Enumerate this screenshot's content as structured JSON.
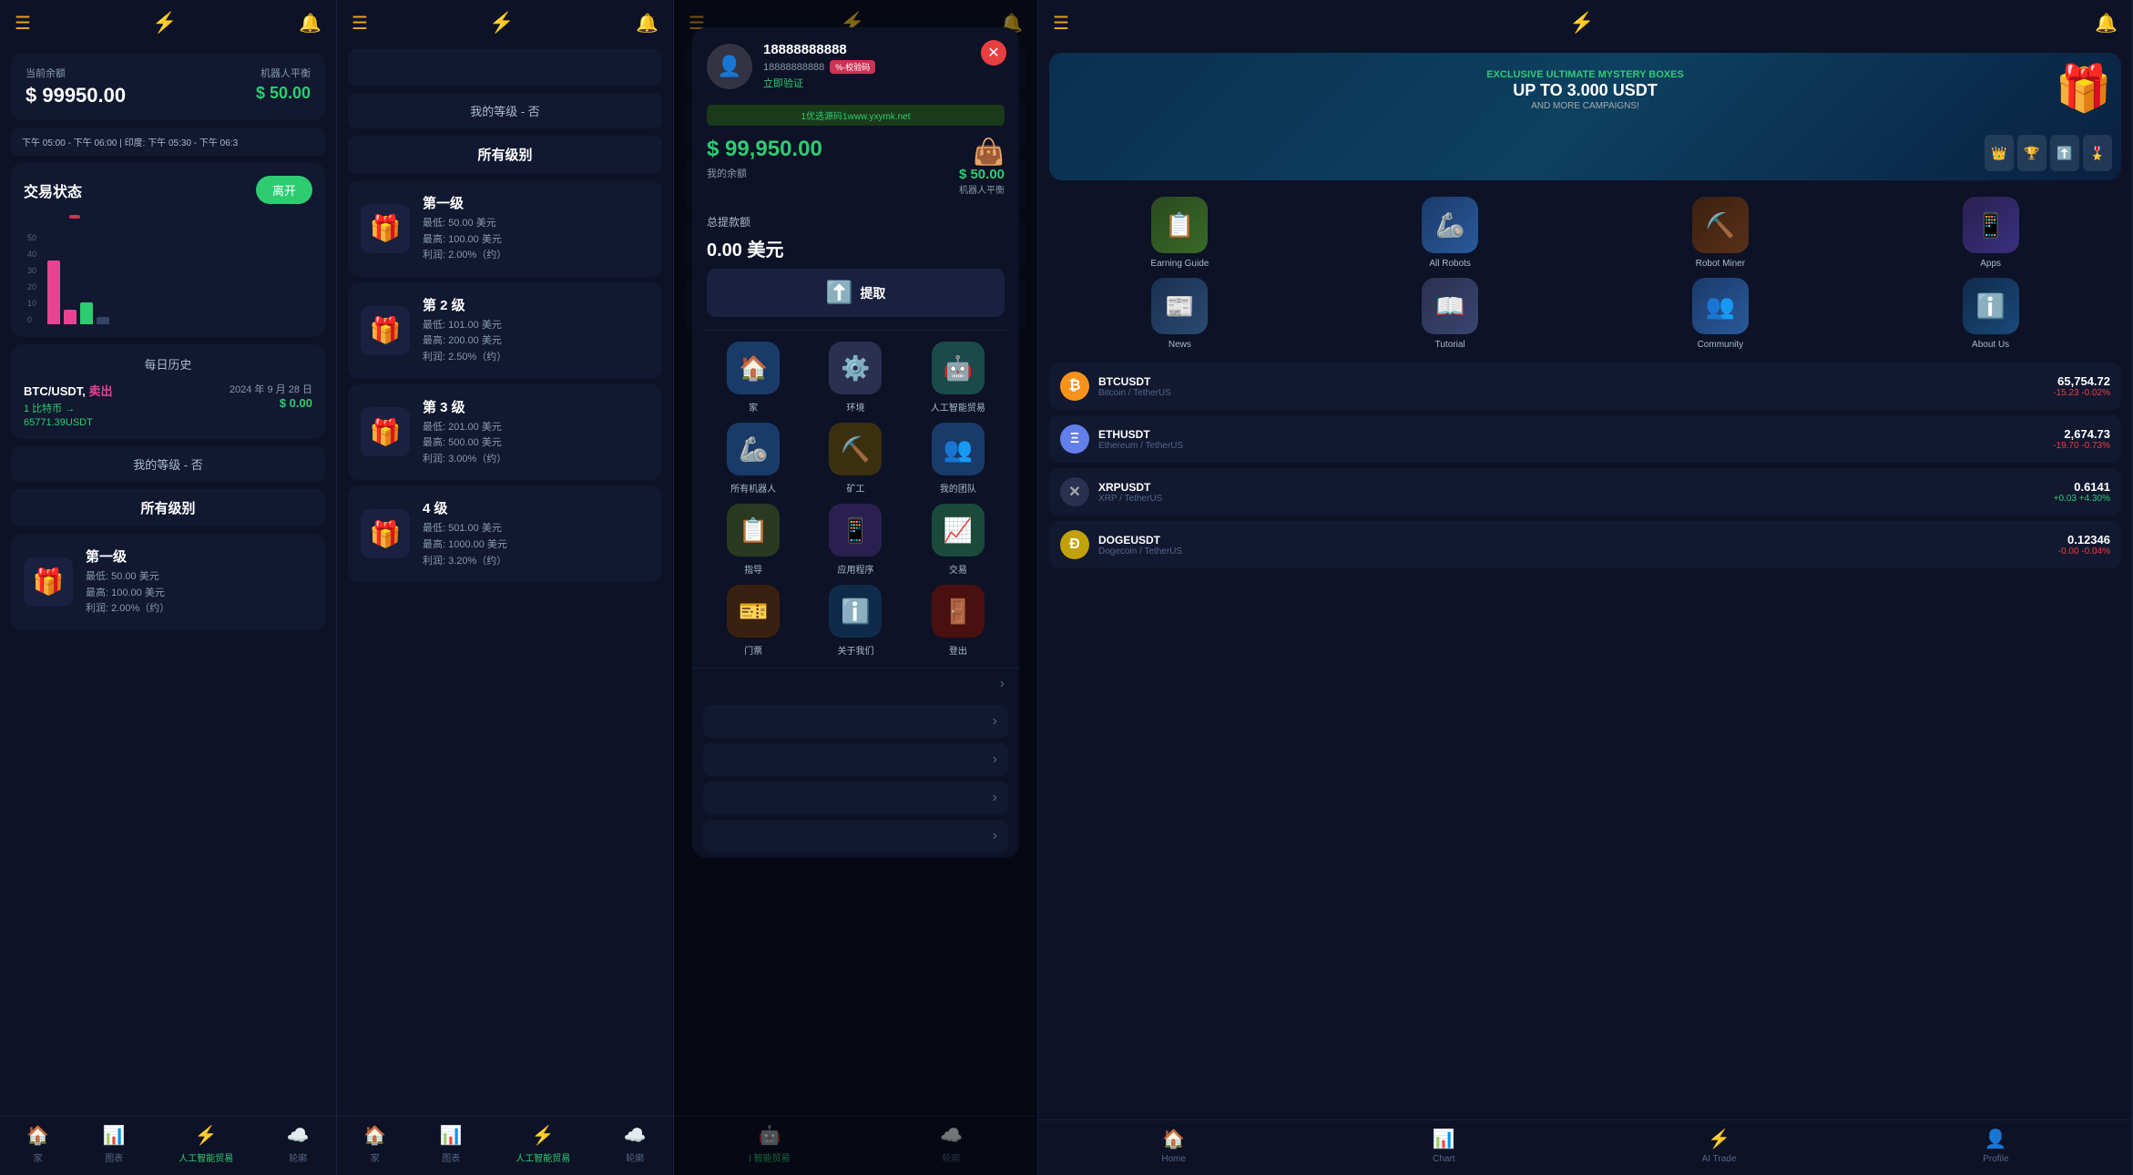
{
  "panels": {
    "p1": {
      "header": {
        "hamburger": "☰",
        "logo": "⚡",
        "bell": "🔔"
      },
      "balance": {
        "label": "当前余额",
        "amount": "$ 99950.00",
        "robot_label": "机器人平衡",
        "robot_amount": "$ 50.00"
      },
      "timebar": "下午 05:00 - 下午 06:00 | 印度: 下午 05:30 - 下午 06:3",
      "trading": {
        "title": "交易状态",
        "leave_btn": "离开",
        "y_labels": [
          "50",
          "40",
          "30",
          "20",
          "10",
          "0"
        ],
        "bars": [
          {
            "type": "pink",
            "height": 35
          },
          {
            "type": "pink",
            "height": 8
          },
          {
            "type": "green",
            "height": 12
          },
          {
            "type": "gray",
            "height": 4
          }
        ]
      },
      "daily_history": {
        "title": "每日历史",
        "item": {
          "pair": "BTC/USDT,",
          "action": "卖出",
          "date": "2024 年 9 月 28 日",
          "sub": "1 比特币 →",
          "sub2": "65771.39USDT",
          "value": "$ 0.00"
        }
      },
      "level_badge": "我的等级 - 否",
      "all_levels_title": "所有级别",
      "levels": [
        {
          "name": "第一级",
          "min": "最低: 50.00 美元",
          "max": "最高: 100.00 美元",
          "profit": "利润: 2.00%（约）"
        }
      ],
      "nav": [
        {
          "icon": "🏠",
          "label": "家",
          "active": false
        },
        {
          "icon": "📊",
          "label": "图表",
          "active": false
        },
        {
          "icon": "⚡",
          "label": "人工智能贸易",
          "active": true
        },
        {
          "icon": "☁️",
          "label": "轮廓",
          "active": false
        }
      ]
    },
    "p2": {
      "header": {
        "hamburger": "☰",
        "logo": "⚡",
        "bell": "🔔"
      },
      "level_badge": "我的等级 - 否",
      "all_levels_title": "所有级别",
      "levels": [
        {
          "name": "第一级",
          "min": "最低: 50.00 美元",
          "max": "最高: 100.00 美元",
          "profit": "利润: 2.00%（约）"
        },
        {
          "name": "第 2 级",
          "min": "最低: 101.00 美元",
          "max": "最高: 200.00 美元",
          "profit": "利润: 2.50%（约）"
        },
        {
          "name": "第 3 级",
          "min": "最低: 201.00 美元",
          "max": "最高: 500.00 美元",
          "profit": "利润: 3.00%（约）"
        },
        {
          "name": "4 级",
          "min": "最低: 501.00 美元",
          "max": "最高: 1000.00 美元",
          "profit": "利润: 3.20%（约）"
        }
      ],
      "nav": [
        {
          "icon": "🏠",
          "label": "家",
          "active": false
        },
        {
          "icon": "📊",
          "label": "图表",
          "active": false
        },
        {
          "icon": "⚡",
          "label": "人工智能贸易",
          "active": true
        },
        {
          "icon": "☁️",
          "label": "轮廓",
          "active": false
        }
      ]
    },
    "p3": {
      "modal": {
        "avatar": "👤",
        "username": "18888888888",
        "user_id": "18888888888",
        "verify_badge": "%-校验码",
        "verify_link": "立即验证",
        "watermark": "1优选源码1www.yxymk.net",
        "balance_amount": "$ 99,950.00",
        "balance_label": "我的余额",
        "robot_amount": "$ 50.00",
        "robot_label": "机器人平衡",
        "withdraw_label": "总提款额",
        "withdraw_amount": "0.00 美元",
        "withdraw_btn": "提取",
        "grid_items": [
          {
            "icon": "🏠",
            "label": "家",
            "color": "icon-blue"
          },
          {
            "icon": "⚙️",
            "label": "环境",
            "color": "icon-gray"
          },
          {
            "icon": "🤖",
            "label": "人工智能贸易",
            "color": "icon-teal"
          },
          {
            "icon": "🦾",
            "label": "所有机器人",
            "color": "icon-robot"
          },
          {
            "icon": "⛏️",
            "label": "矿工",
            "color": "icon-yellow"
          },
          {
            "icon": "👥",
            "label": "我的团队",
            "color": "icon-team"
          },
          {
            "icon": "📋",
            "label": "指导",
            "color": "icon-guide"
          },
          {
            "icon": "📱",
            "label": "应用程序",
            "color": "icon-apps"
          },
          {
            "icon": "📈",
            "label": "交易",
            "color": "icon-trade"
          },
          {
            "icon": "🎫",
            "label": "门票",
            "color": "icon-ticket"
          },
          {
            "icon": "ℹ️",
            "label": "关于我们",
            "color": "icon-about"
          },
          {
            "icon": "🚪",
            "label": "登出",
            "color": "icon-logout"
          }
        ]
      },
      "background_nav": [
        {
          "icon": "🤖",
          "label": "I 智能贸易",
          "active": true
        },
        {
          "icon": "☁️",
          "label": "轮廓",
          "active": false
        }
      ]
    },
    "p4": {
      "header": {
        "hamburger": "☰",
        "logo": "⚡",
        "bell": "🔔"
      },
      "promo": {
        "top": "EXCLUSIVE ULTIMATE MYSTERY BOXES",
        "main": "UP TO 3.000 USDT",
        "sub": "AND MORE CAMPAIGNS!"
      },
      "app_items": [
        {
          "icon": "📋",
          "label": "Earning Guide",
          "color": "icon-earn"
        },
        {
          "icon": "🦾",
          "label": "All Robots",
          "color": "icon-allrobots"
        },
        {
          "icon": "⛏️",
          "label": "Robot Miner",
          "color": "icon-robominer"
        },
        {
          "icon": "📱",
          "label": "Apps",
          "color": "icon-appsb"
        },
        {
          "icon": "📰",
          "label": "News",
          "color": "icon-newsb"
        },
        {
          "icon": "📖",
          "label": "Tutorial",
          "color": "icon-tutorial"
        },
        {
          "icon": "👥",
          "label": "Community",
          "color": "icon-communityb"
        },
        {
          "icon": "ℹ️",
          "label": "About Us",
          "color": "icon-aboutb"
        }
      ],
      "crypto": [
        {
          "symbol": "₿",
          "name": "BTCUSDT",
          "subname": "Bitcoin / TetherUS",
          "price": "65,754.72",
          "change": "-15.23  -0.02%",
          "change_type": "neg",
          "coin_color": "btc-color"
        },
        {
          "symbol": "Ξ",
          "name": "ETHUSDT",
          "subname": "Ethereum / TetherUS",
          "price": "2,674.73",
          "change": "-19.70  -0.73%",
          "change_type": "neg",
          "coin_color": "eth-color"
        },
        {
          "symbol": "✕",
          "name": "XRPUSDT",
          "subname": "XRP / TetherUS",
          "price": "0.6141",
          "change": "+0.03  +4.30%",
          "change_type": "pos",
          "coin_color": "xrp-color"
        },
        {
          "symbol": "Ð",
          "name": "DOGEUSDT",
          "subname": "Dogecoin / TetherUS",
          "price": "0.12346",
          "change": "-0.00  -0.04%",
          "change_type": "neg",
          "coin_color": "doge-color"
        }
      ],
      "nav": [
        {
          "icon": "🏠",
          "label": "Home",
          "active": false
        },
        {
          "icon": "📊",
          "label": "Chart",
          "active": false
        },
        {
          "icon": "⚡",
          "label": "AI Trade",
          "active": false
        },
        {
          "icon": "👤",
          "label": "Profile",
          "active": false
        }
      ]
    }
  }
}
